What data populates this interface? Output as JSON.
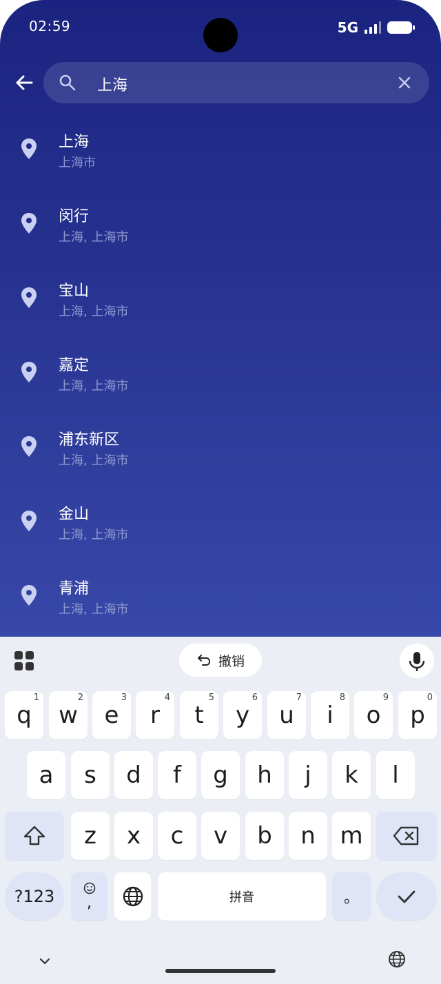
{
  "status": {
    "time": "02:59",
    "network": "5G"
  },
  "search": {
    "query": "上海"
  },
  "results": [
    {
      "title": "上海",
      "subtitle": "上海市"
    },
    {
      "title": "闵行",
      "subtitle": "上海, 上海市"
    },
    {
      "title": "宝山",
      "subtitle": "上海, 上海市"
    },
    {
      "title": "嘉定",
      "subtitle": "上海, 上海市"
    },
    {
      "title": "浦东新区",
      "subtitle": "上海, 上海市"
    },
    {
      "title": "金山",
      "subtitle": "上海, 上海市"
    },
    {
      "title": "青浦",
      "subtitle": "上海, 上海市"
    }
  ],
  "keyboard": {
    "undo_label": "撤销",
    "row1": [
      {
        "k": "q",
        "n": "1"
      },
      {
        "k": "w",
        "n": "2"
      },
      {
        "k": "e",
        "n": "3"
      },
      {
        "k": "r",
        "n": "4"
      },
      {
        "k": "t",
        "n": "5"
      },
      {
        "k": "y",
        "n": "6"
      },
      {
        "k": "u",
        "n": "7"
      },
      {
        "k": "i",
        "n": "8"
      },
      {
        "k": "o",
        "n": "9"
      },
      {
        "k": "p",
        "n": "0"
      }
    ],
    "row2": [
      "a",
      "s",
      "d",
      "f",
      "g",
      "h",
      "j",
      "k",
      "l"
    ],
    "row3": [
      "z",
      "x",
      "c",
      "v",
      "b",
      "n",
      "m"
    ],
    "symbols_label": "?123",
    "comma_label": ",",
    "space_label": "拼音",
    "period_label": "。"
  },
  "colors": {
    "accent": "#1b2380",
    "key_special": "#dfe4f6"
  }
}
